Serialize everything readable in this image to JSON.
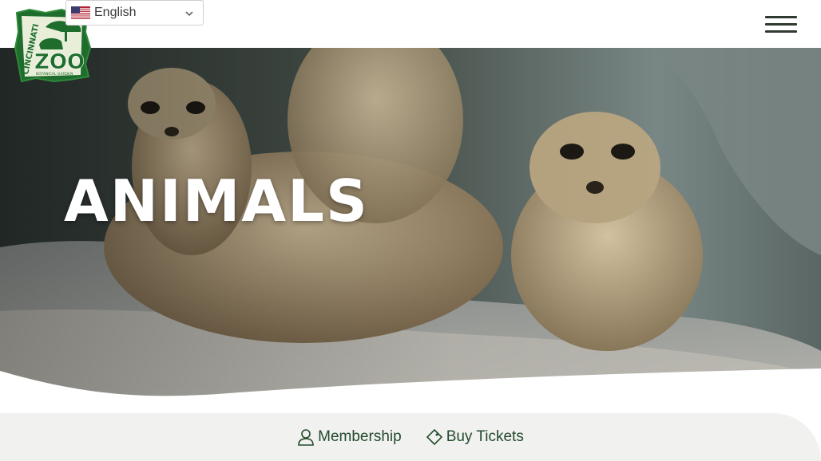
{
  "logo": {
    "name": "Cincinnati Zoo & Botanical Garden",
    "text_top": "CINCINNATI",
    "text_main": "ZOO",
    "text_sub": "BOTANICAL GARDEN"
  },
  "language": {
    "selected": "English",
    "flag_code": "en"
  },
  "menu": {
    "icon": "hamburger-menu-icon"
  },
  "hero": {
    "title": "ANIMALS"
  },
  "quicklinks": [
    {
      "label": "Membership",
      "icon": "user-icon"
    },
    {
      "label": "Buy Tickets",
      "icon": "ticket-icon"
    }
  ],
  "colors": {
    "brand_green": "#1d6b2c",
    "link_green": "#234b2c",
    "bar_bg": "#f1f1ef"
  }
}
